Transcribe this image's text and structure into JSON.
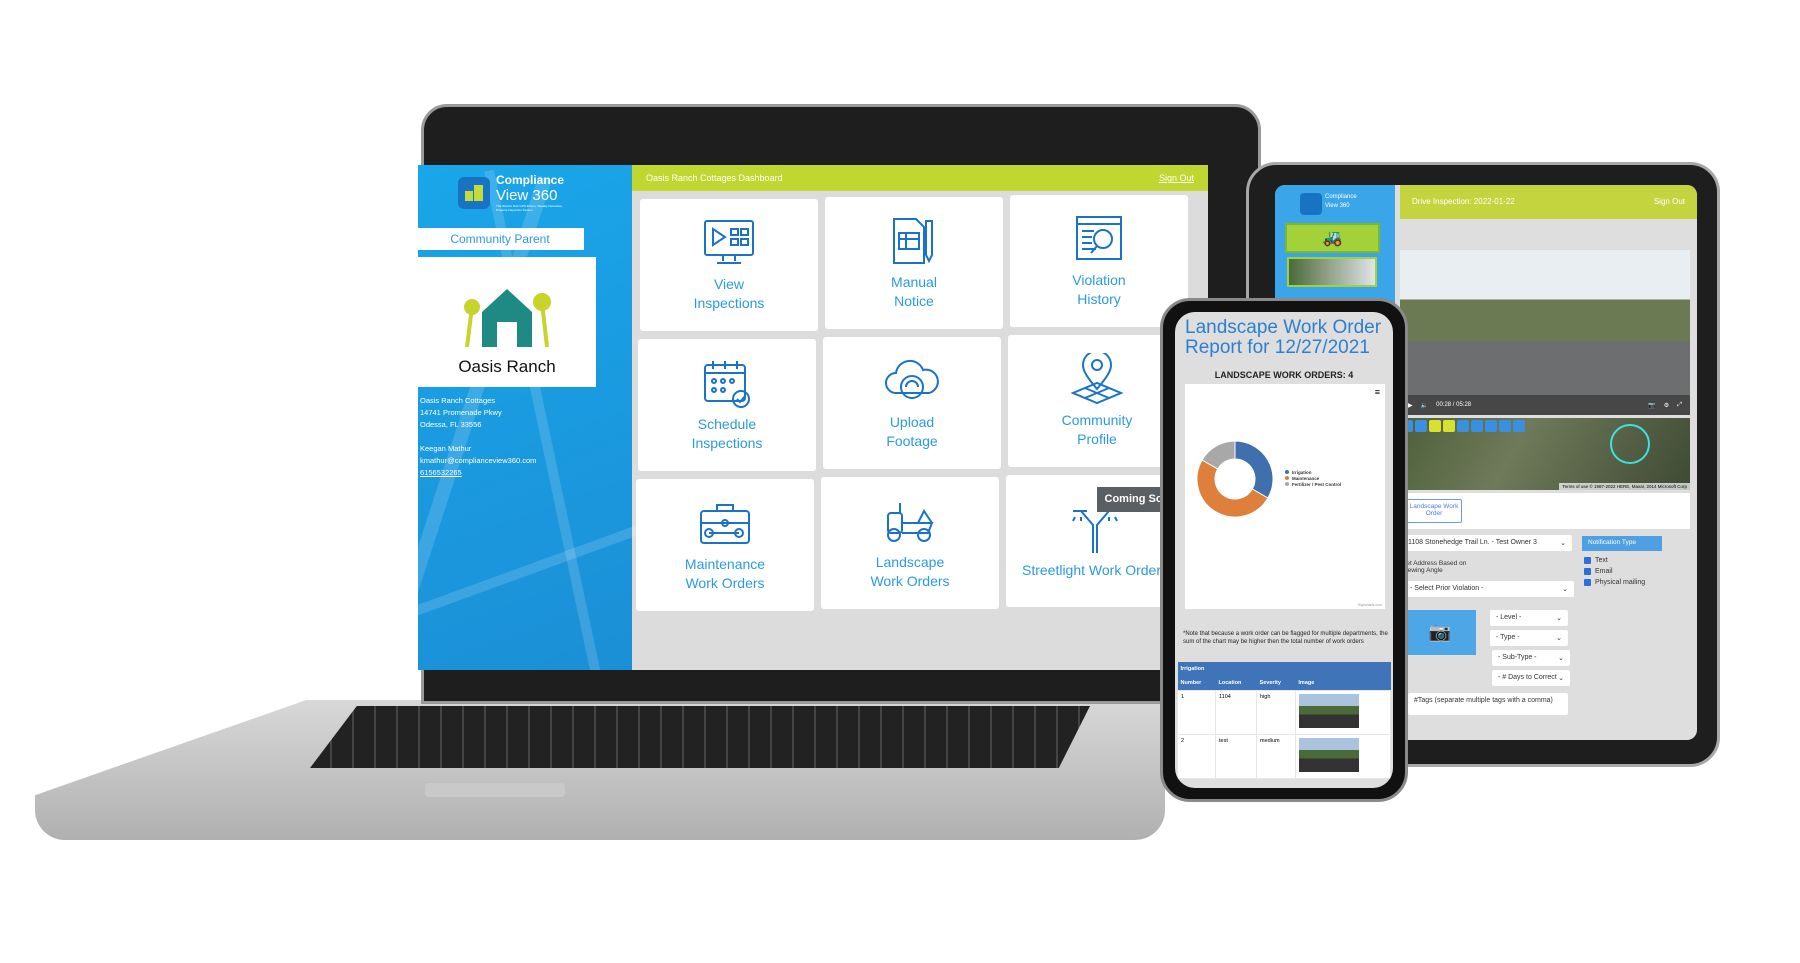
{
  "laptop": {
    "brand": {
      "name_line1": "Compliance",
      "name_line2": "View 360",
      "tagline": "The World's First GPS-Driven, Visually Interactive, Property Inspection System"
    },
    "community_parent_label": "Community Parent",
    "community_logo_text": "Oasis Ranch",
    "address": {
      "name": "Oasis Ranch Cottages",
      "street": "14741 Promenade Pkwy",
      "city": "Odessa, FL 33556"
    },
    "contact": {
      "name": "Keegan Mathur",
      "email": "kmathur@complianceview360.com",
      "phone": "6156532265"
    },
    "header": {
      "title": "Oasis Ranch Cottages Dashboard",
      "sign_out": "Sign Out"
    },
    "tiles": [
      {
        "line1": "View",
        "line2": "Inspections",
        "icon": "monitor-video-icon"
      },
      {
        "line1": "Manual",
        "line2": "Notice",
        "icon": "document-pen-icon"
      },
      {
        "line1": "Violation",
        "line2": "History",
        "icon": "browser-search-icon"
      },
      {
        "line1": "Schedule",
        "line2": "Inspections",
        "icon": "calendar-check-icon"
      },
      {
        "line1": "Upload",
        "line2": "Footage",
        "icon": "cloud-upload-icon"
      },
      {
        "line1": "Community",
        "line2": "Profile",
        "icon": "map-pin-user-icon"
      },
      {
        "line1": "Maintenance",
        "line2": "Work Orders",
        "icon": "toolbox-icon"
      },
      {
        "line1": "Landscape",
        "line2": "Work Orders",
        "icon": "mower-icon"
      },
      {
        "line1": "Streetlight Work Orders",
        "line2": "",
        "icon": "streetlight-icon",
        "badge": "Coming Soon"
      }
    ]
  },
  "tablet": {
    "header": {
      "title": "Drive Inspection: 2022-01-22",
      "sign_out": "Sign Out"
    },
    "video": {
      "time": "00:28 / 05:28"
    },
    "map": {
      "attribution": "Terms of use   © 1987-2022 HERE, Maxar, 2014 Microsoft Corp"
    },
    "form": {
      "work_order_button": "Landscape Work Order",
      "address_select": "1108 Stonehedge Trail Ln. - Test Owner 3",
      "set_address_label": "Set Address Based on Viewing Angle",
      "prior_violation_select": "- Select Prior Violation -",
      "level_select": "- Level -",
      "type_select": "- Type -",
      "subtype_select": "- Sub-Type -",
      "days_select": "- # Days to Correct",
      "tags_placeholder": "#Tags (separate multiple tags with a comma)",
      "notification_header": "Notification Type",
      "notifications": [
        "Text",
        "Email",
        "Physical mailing"
      ]
    }
  },
  "phone": {
    "title": "Landscape Work Order Report for 12/27/2021",
    "chart_title": "LANDSCAPE WORK ORDERS: 4",
    "credit": "Highcharts.com",
    "note": "*Note that because a work order can be flagged for multiple departments, the sum of the chart may be higher then the total number of work orders",
    "table": {
      "section": "Irrigation",
      "headers": [
        "Number",
        "Location",
        "Severity",
        "Image"
      ],
      "rows": [
        [
          "1",
          "1104",
          "high"
        ],
        [
          "2",
          "test",
          "medium"
        ]
      ]
    }
  },
  "chart_data": {
    "type": "pie",
    "donut": true,
    "title": "LANDSCAPE WORK ORDERS: 4",
    "legend": "right",
    "categories": [
      "Irrigation",
      "Maintenance",
      "Fertilizer / Pest Control"
    ],
    "values": [
      2,
      3,
      1
    ],
    "colors": [
      "#3f6fad",
      "#df7f3c",
      "#a8a8a8"
    ]
  },
  "colors": {
    "brand_blue": "#1ba0e6",
    "accent_green": "#bfd730",
    "tile_text": "#2a9be0"
  }
}
